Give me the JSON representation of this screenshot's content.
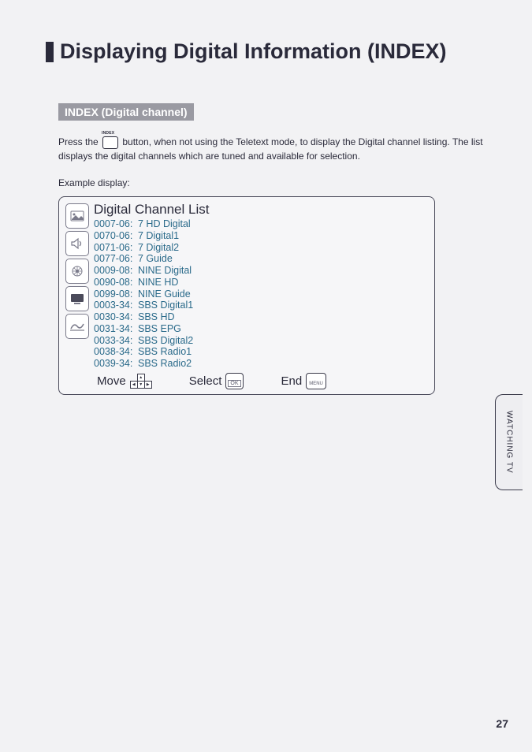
{
  "title": "Displaying Digital Information (INDEX)",
  "subheader": "INDEX (Digital channel)",
  "body_pre": "Press the ",
  "body_post": " button, when not using the Teletext mode, to display the Digital channel listing. The list displays the digital channels which are tuned and available for selection.",
  "example_label": "Example display:",
  "list_title": "Digital Channel List",
  "channels": [
    {
      "num": "0007-06:",
      "name": "7 HD Digital"
    },
    {
      "num": "0070-06:",
      "name": "7 Digital1"
    },
    {
      "num": "0071-06:",
      "name": "7 Digital2"
    },
    {
      "num": "0077-06:",
      "name": "7 Guide"
    },
    {
      "num": "0009-08:",
      "name": "NINE Digital"
    },
    {
      "num": "0090-08:",
      "name": "NINE HD"
    },
    {
      "num": "0099-08:",
      "name": "NINE Guide"
    },
    {
      "num": "0003-34:",
      "name": "SBS Digital1"
    },
    {
      "num": "0030-34:",
      "name": "SBS HD"
    },
    {
      "num": "0031-34:",
      "name": "SBS EPG"
    },
    {
      "num": "0033-34:",
      "name": "SBS Digital2"
    },
    {
      "num": "0038-34:",
      "name": "SBS Radio1"
    },
    {
      "num": "0039-34:",
      "name": "SBS Radio2"
    }
  ],
  "footer": {
    "move": "Move",
    "select": "Select",
    "end": "End",
    "ok": "OK",
    "menu": "MENU"
  },
  "side_tab": "WATCHING TV",
  "page_num": "27"
}
